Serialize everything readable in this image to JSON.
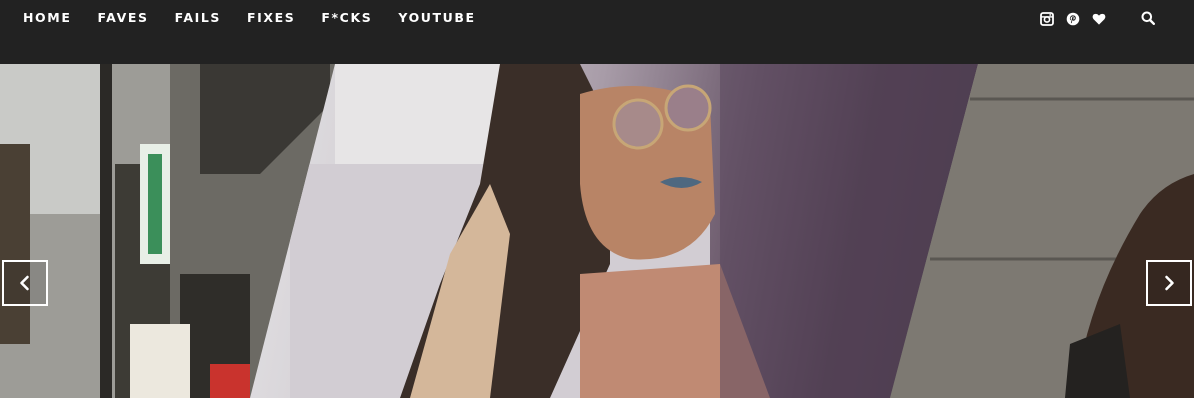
{
  "nav": {
    "links": [
      {
        "label": "HOME"
      },
      {
        "label": "FAVES"
      },
      {
        "label": "FAILS"
      },
      {
        "label": "FIXES"
      },
      {
        "label": "F*CKS"
      },
      {
        "label": "YOUTUBE"
      }
    ],
    "icons": [
      "instagram-icon",
      "pinterest-icon",
      "heart-icon",
      "search-icon"
    ]
  },
  "carousel": {
    "slides": [
      {
        "description_hidden": true,
        "name": "slide-street"
      },
      {
        "description_hidden": true,
        "name": "slide-woman-sunglasses"
      },
      {
        "description_hidden": true,
        "name": "slide-concrete-wall"
      }
    ],
    "prev_icon": "chevron-left-icon",
    "next_icon": "chevron-right-icon"
  },
  "colors": {
    "nav_background": "#222222",
    "nav_text": "#ffffff",
    "arrow_border": "#ffffff"
  }
}
